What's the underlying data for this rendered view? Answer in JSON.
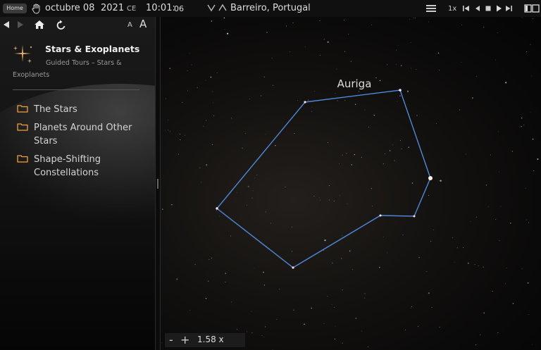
{
  "topbar": {
    "home_label": "Home",
    "month_day": "octubre 08",
    "year": "2021",
    "era": "CE",
    "time_hm": "10:01:",
    "time_s": "06",
    "location": "Barreiro, Portugal",
    "speed": "1x"
  },
  "sidebar": {
    "font_small_label": "A",
    "font_large_label": "A",
    "tour_title": "Stars & Exoplanets",
    "tour_subtitle": "Guided Tours – Stars & Exoplanets",
    "items": [
      {
        "label": "The Stars"
      },
      {
        "label": "Planets Around Other Stars"
      },
      {
        "label": "Shape-Shifting Constellations"
      }
    ]
  },
  "sky": {
    "constellation_label": "Auriga",
    "line_color": "#4f87d8"
  },
  "zoom": {
    "minus": "-",
    "plus": "+",
    "value": "1.58 x"
  },
  "colors": {
    "accent_folder": "#f0a040",
    "topbar_bg": "#101010"
  }
}
